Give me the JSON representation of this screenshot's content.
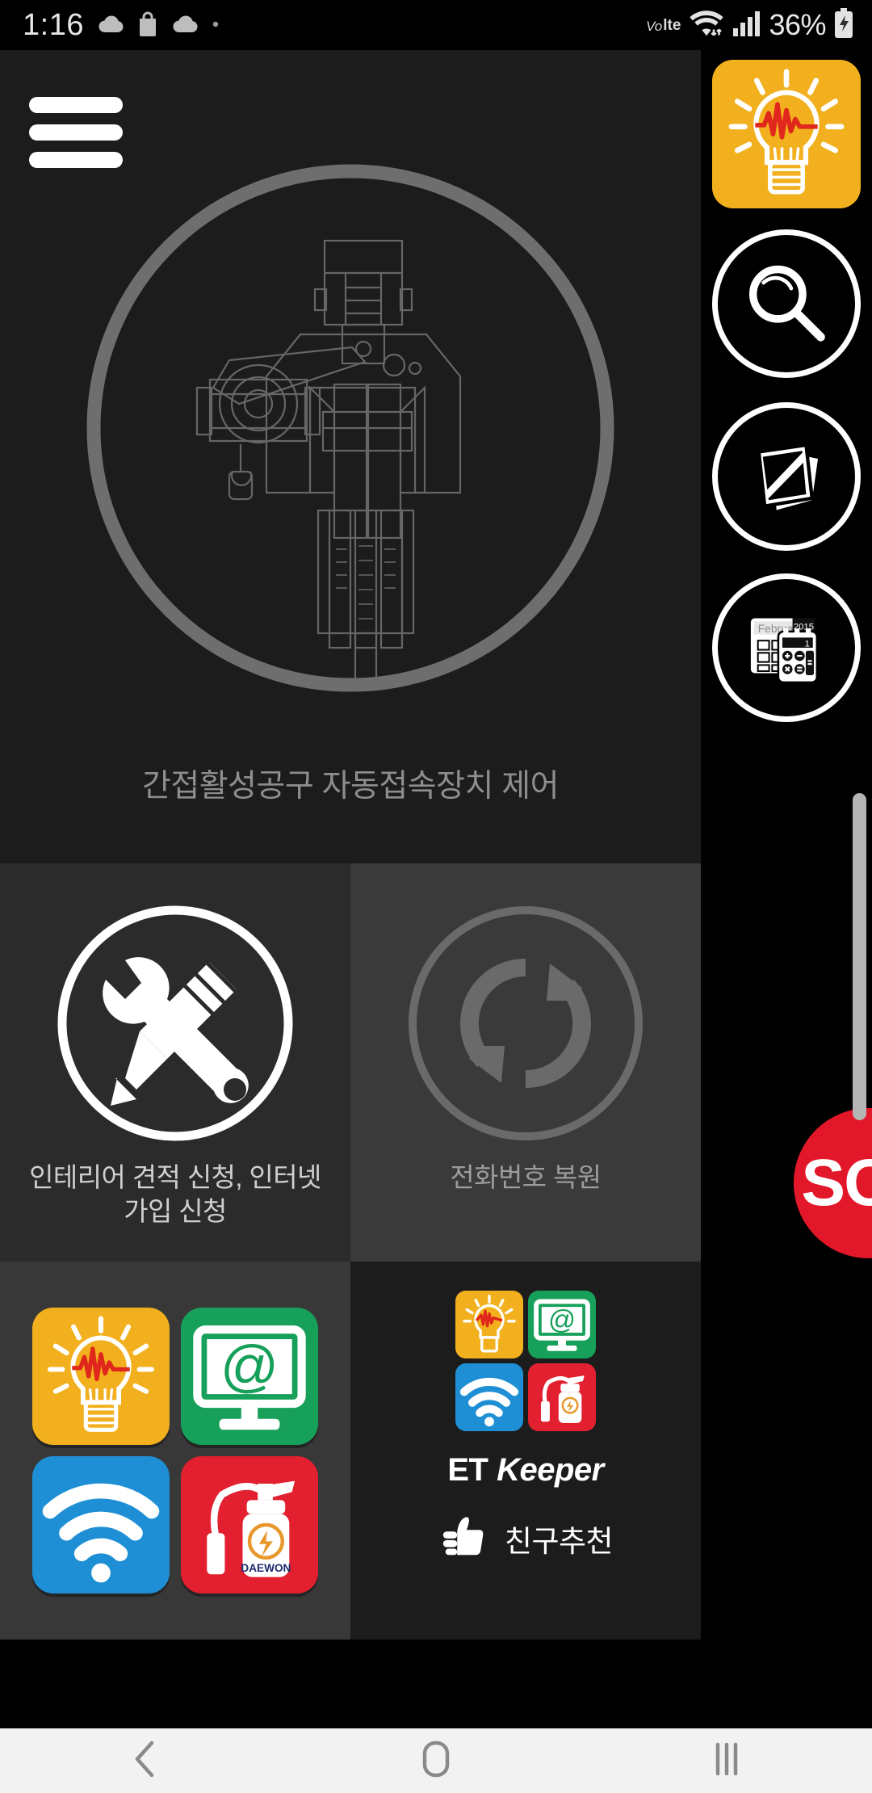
{
  "status_bar": {
    "clock": "1:16",
    "battery_percent": "36%",
    "network_volte_prefix": "Vo",
    "network_volte_suffix": "lte",
    "left_icons": [
      "cloud-icon",
      "shopping-bag-icon",
      "cloud-icon",
      "dot-icon"
    ],
    "right_icons": [
      "volte-icon",
      "wifi-icon",
      "signal-bars-icon",
      "battery-charging-icon"
    ]
  },
  "hero": {
    "menu_icon": "hamburger-menu-icon",
    "artwork_icon": "hot-line-tool-diagram",
    "caption": "간접활성공구 자동접속장치 제어"
  },
  "cards": [
    {
      "id": "service-request",
      "icon": "wrench-screwdriver-icon",
      "label": "인테리어 견적 신청, 인터넷 가입 신청",
      "label_line1": "인테리어 견적 신청, 인터넷",
      "label_line2": "가입 신청",
      "enabled": true,
      "bg": "#2b2b2b"
    },
    {
      "id": "phone-restore",
      "icon": "sync-restore-icon",
      "label": "전화번호 복원",
      "enabled": false,
      "bg": "#3a3a3a"
    }
  ],
  "app_grid": {
    "tiles": [
      {
        "name": "lightbulb-waveform-app",
        "color": "#f2b01e",
        "icon": "bulb-waveform-icon"
      },
      {
        "name": "internet-monitor-app",
        "color": "#17a05a",
        "icon": "monitor-at-icon"
      },
      {
        "name": "wifi-app",
        "color": "#1e8fd5",
        "icon": "wifi-icon"
      },
      {
        "name": "fire-extinguisher-app",
        "color": "#e2202f",
        "icon": "fire-extinguisher-icon",
        "brand": "DAEWON"
      }
    ]
  },
  "brand": {
    "logo_tiles": [
      {
        "name": "lightbulb-waveform-app",
        "color": "#f2b01e"
      },
      {
        "name": "internet-monitor-app",
        "color": "#17a05a"
      },
      {
        "name": "wifi-app",
        "color": "#1e8fd5"
      },
      {
        "name": "fire-extinguisher-app",
        "color": "#e2202f"
      }
    ],
    "name_first": "ET",
    "name_second": "Keeper",
    "refer_icon": "thumbs-up-icon",
    "refer_label": "친구추천"
  },
  "right_rail": {
    "buttons": [
      {
        "name": "lightbulb-shortcut",
        "icon": "bulb-waveform-icon",
        "style": "tile",
        "color": "#f2b01e"
      },
      {
        "name": "search-shortcut",
        "icon": "magnifier-icon",
        "style": "circle",
        "color": "#ffffff"
      },
      {
        "name": "documents-shortcut",
        "icon": "documents-icon",
        "style": "circle",
        "color": "#ffffff"
      },
      {
        "name": "calendar-calculator-shortcut",
        "icon": "calendar-calculator-icon",
        "style": "circle",
        "color": "#ffffff",
        "calendar_month": "February",
        "calendar_year": "2015"
      }
    ],
    "sos": {
      "label": "SOS",
      "color": "#e3172a"
    }
  },
  "scrollbar": {
    "visible": true
  },
  "nav_bar": {
    "buttons": [
      {
        "name": "back-button",
        "icon": "chevron-left-icon"
      },
      {
        "name": "home-button",
        "icon": "home-square-icon"
      },
      {
        "name": "recents-button",
        "icon": "recents-bars-icon"
      }
    ]
  }
}
